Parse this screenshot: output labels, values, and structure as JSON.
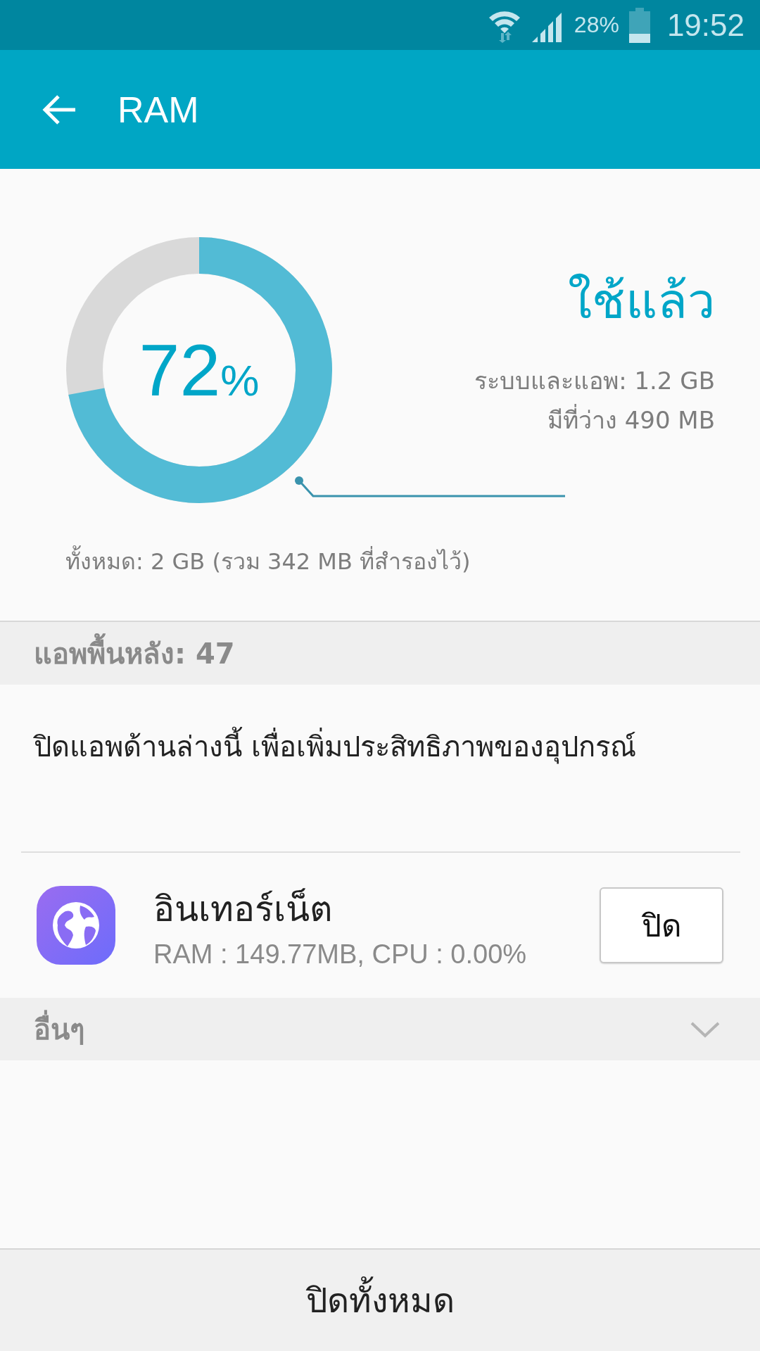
{
  "status_bar": {
    "battery_text": "28%",
    "time": "19:52"
  },
  "app_bar": {
    "title": "RAM"
  },
  "memory": {
    "percent": "72",
    "percent_sign": "%",
    "level": 0.72,
    "used_label": "ใช้แล้ว",
    "system_apps": "ระบบและแอพ: 1.2 GB",
    "free": "มีที่ว่าง 490 MB",
    "total": "ทั้งหมด: 2 GB (รวม 342 MB ที่สำรองไว้)"
  },
  "background_apps": {
    "header": "แอพพื้นหลัง: 47",
    "description": "ปิดแอพด้านล่างนี้ เพื่อเพิ่มประสิทธิภาพของอุปกรณ์",
    "apps": [
      {
        "name": "อินเทอร์เน็ต",
        "usage": "RAM : 149.77MB, CPU : 0.00%",
        "button": "ปิด"
      }
    ]
  },
  "others": {
    "header": "อื่นๆ",
    "expanded": false
  },
  "bottom_button": "ปิดทั้งหมด"
}
